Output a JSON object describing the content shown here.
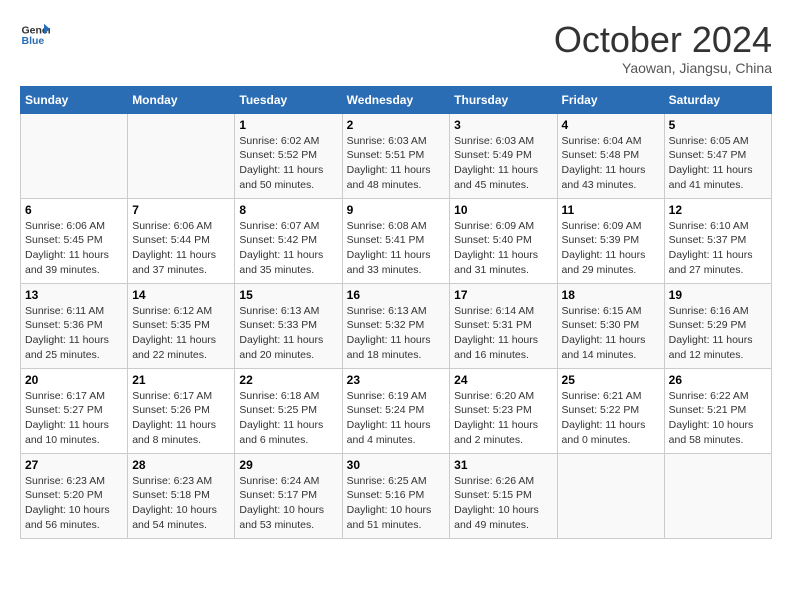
{
  "header": {
    "logo_line1": "General",
    "logo_line2": "Blue",
    "month": "October 2024",
    "location": "Yaowan, Jiangsu, China"
  },
  "weekdays": [
    "Sunday",
    "Monday",
    "Tuesday",
    "Wednesday",
    "Thursday",
    "Friday",
    "Saturday"
  ],
  "weeks": [
    [
      {
        "day": "",
        "info": ""
      },
      {
        "day": "",
        "info": ""
      },
      {
        "day": "1",
        "info": "Sunrise: 6:02 AM\nSunset: 5:52 PM\nDaylight: 11 hours and 50 minutes."
      },
      {
        "day": "2",
        "info": "Sunrise: 6:03 AM\nSunset: 5:51 PM\nDaylight: 11 hours and 48 minutes."
      },
      {
        "day": "3",
        "info": "Sunrise: 6:03 AM\nSunset: 5:49 PM\nDaylight: 11 hours and 45 minutes."
      },
      {
        "day": "4",
        "info": "Sunrise: 6:04 AM\nSunset: 5:48 PM\nDaylight: 11 hours and 43 minutes."
      },
      {
        "day": "5",
        "info": "Sunrise: 6:05 AM\nSunset: 5:47 PM\nDaylight: 11 hours and 41 minutes."
      }
    ],
    [
      {
        "day": "6",
        "info": "Sunrise: 6:06 AM\nSunset: 5:45 PM\nDaylight: 11 hours and 39 minutes."
      },
      {
        "day": "7",
        "info": "Sunrise: 6:06 AM\nSunset: 5:44 PM\nDaylight: 11 hours and 37 minutes."
      },
      {
        "day": "8",
        "info": "Sunrise: 6:07 AM\nSunset: 5:42 PM\nDaylight: 11 hours and 35 minutes."
      },
      {
        "day": "9",
        "info": "Sunrise: 6:08 AM\nSunset: 5:41 PM\nDaylight: 11 hours and 33 minutes."
      },
      {
        "day": "10",
        "info": "Sunrise: 6:09 AM\nSunset: 5:40 PM\nDaylight: 11 hours and 31 minutes."
      },
      {
        "day": "11",
        "info": "Sunrise: 6:09 AM\nSunset: 5:39 PM\nDaylight: 11 hours and 29 minutes."
      },
      {
        "day": "12",
        "info": "Sunrise: 6:10 AM\nSunset: 5:37 PM\nDaylight: 11 hours and 27 minutes."
      }
    ],
    [
      {
        "day": "13",
        "info": "Sunrise: 6:11 AM\nSunset: 5:36 PM\nDaylight: 11 hours and 25 minutes."
      },
      {
        "day": "14",
        "info": "Sunrise: 6:12 AM\nSunset: 5:35 PM\nDaylight: 11 hours and 22 minutes."
      },
      {
        "day": "15",
        "info": "Sunrise: 6:13 AM\nSunset: 5:33 PM\nDaylight: 11 hours and 20 minutes."
      },
      {
        "day": "16",
        "info": "Sunrise: 6:13 AM\nSunset: 5:32 PM\nDaylight: 11 hours and 18 minutes."
      },
      {
        "day": "17",
        "info": "Sunrise: 6:14 AM\nSunset: 5:31 PM\nDaylight: 11 hours and 16 minutes."
      },
      {
        "day": "18",
        "info": "Sunrise: 6:15 AM\nSunset: 5:30 PM\nDaylight: 11 hours and 14 minutes."
      },
      {
        "day": "19",
        "info": "Sunrise: 6:16 AM\nSunset: 5:29 PM\nDaylight: 11 hours and 12 minutes."
      }
    ],
    [
      {
        "day": "20",
        "info": "Sunrise: 6:17 AM\nSunset: 5:27 PM\nDaylight: 11 hours and 10 minutes."
      },
      {
        "day": "21",
        "info": "Sunrise: 6:17 AM\nSunset: 5:26 PM\nDaylight: 11 hours and 8 minutes."
      },
      {
        "day": "22",
        "info": "Sunrise: 6:18 AM\nSunset: 5:25 PM\nDaylight: 11 hours and 6 minutes."
      },
      {
        "day": "23",
        "info": "Sunrise: 6:19 AM\nSunset: 5:24 PM\nDaylight: 11 hours and 4 minutes."
      },
      {
        "day": "24",
        "info": "Sunrise: 6:20 AM\nSunset: 5:23 PM\nDaylight: 11 hours and 2 minutes."
      },
      {
        "day": "25",
        "info": "Sunrise: 6:21 AM\nSunset: 5:22 PM\nDaylight: 11 hours and 0 minutes."
      },
      {
        "day": "26",
        "info": "Sunrise: 6:22 AM\nSunset: 5:21 PM\nDaylight: 10 hours and 58 minutes."
      }
    ],
    [
      {
        "day": "27",
        "info": "Sunrise: 6:23 AM\nSunset: 5:20 PM\nDaylight: 10 hours and 56 minutes."
      },
      {
        "day": "28",
        "info": "Sunrise: 6:23 AM\nSunset: 5:18 PM\nDaylight: 10 hours and 54 minutes."
      },
      {
        "day": "29",
        "info": "Sunrise: 6:24 AM\nSunset: 5:17 PM\nDaylight: 10 hours and 53 minutes."
      },
      {
        "day": "30",
        "info": "Sunrise: 6:25 AM\nSunset: 5:16 PM\nDaylight: 10 hours and 51 minutes."
      },
      {
        "day": "31",
        "info": "Sunrise: 6:26 AM\nSunset: 5:15 PM\nDaylight: 10 hours and 49 minutes."
      },
      {
        "day": "",
        "info": ""
      },
      {
        "day": "",
        "info": ""
      }
    ]
  ]
}
